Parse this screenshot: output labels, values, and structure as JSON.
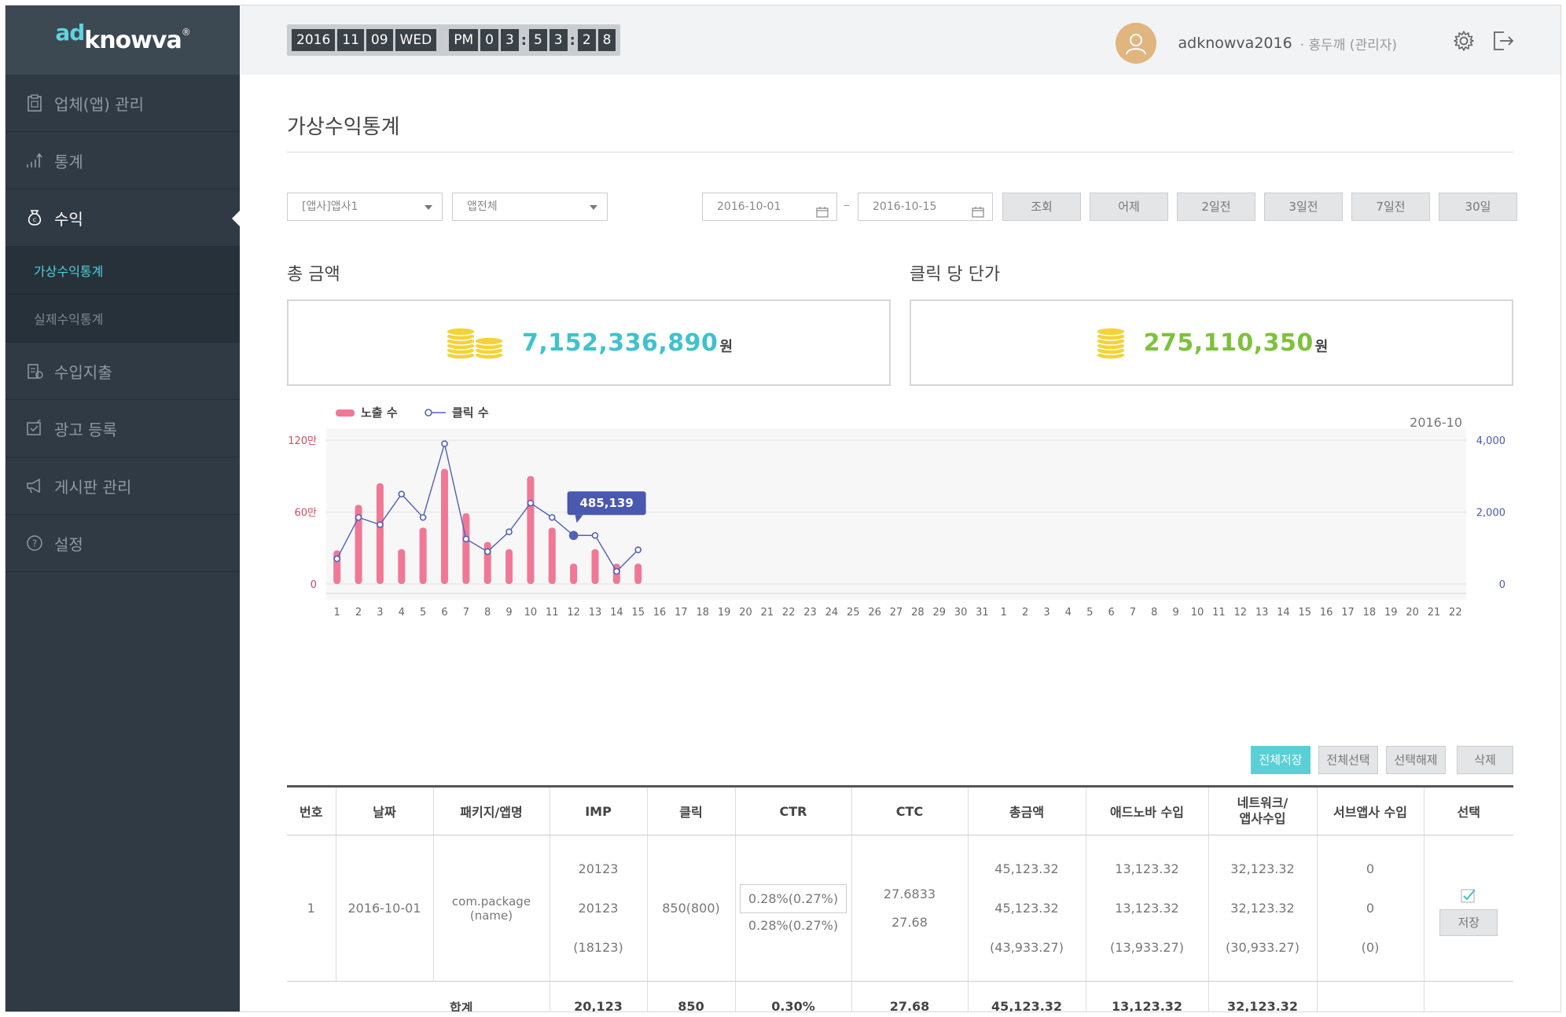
{
  "logo": {
    "ad": "ad",
    "knowva": "knowva",
    "reg": "®"
  },
  "sidebar": {
    "items": [
      {
        "label": "업체(앱) 관리",
        "icon": "clipboard-icon"
      },
      {
        "label": "통계",
        "icon": "bar-chart-icon"
      },
      {
        "label": "수익",
        "icon": "money-bag-icon"
      },
      {
        "label": "수입지출",
        "icon": "receipt-icon"
      },
      {
        "label": "광고 등록",
        "icon": "edit-check-icon"
      },
      {
        "label": "게시판 관리",
        "icon": "megaphone-icon"
      },
      {
        "label": "설정",
        "icon": "question-circle-icon"
      }
    ],
    "subitems": [
      {
        "label": "가상수익통계"
      },
      {
        "label": "실제수익통계"
      }
    ]
  },
  "clock": {
    "year": "2016",
    "month": "11",
    "day": "09",
    "weekday": "WED",
    "ampm": "PM",
    "h1": "0",
    "h2": "3",
    "m1": "5",
    "m2": "3",
    "s1": "2",
    "s2": "8"
  },
  "user": {
    "id": "adknowva2016",
    "sep": "·",
    "role": "홍두깨 (관리자)"
  },
  "page": {
    "title": "가상수익통계"
  },
  "filters": {
    "company_select": "[앱사]앱사1",
    "app_select": "앱전체",
    "date_from": "2016-10-01",
    "date_to": "2016-10-15",
    "dash": "–",
    "buttons": [
      "조회",
      "어제",
      "2일전",
      "3일전",
      "7일전",
      "30일"
    ]
  },
  "summary": {
    "total_label": "총 금액",
    "total_value": "7,152,336,890",
    "total_unit": "원",
    "cpc_label": "클릭 당 단가",
    "cpc_value": "275,110,350",
    "cpc_unit": "원",
    "colors": {
      "total": "#3fc2cc",
      "cpc": "#7cc23a",
      "coin": "#f3d33a"
    }
  },
  "chart_data": {
    "type": "bar",
    "period_label": "2016-10",
    "legend": [
      "노출 수",
      "클릭 수"
    ],
    "categories": [
      "1",
      "2",
      "3",
      "4",
      "5",
      "6",
      "7",
      "8",
      "9",
      "10",
      "11",
      "12",
      "13",
      "14",
      "15",
      "16",
      "17",
      "18",
      "19",
      "20",
      "21",
      "22",
      "23",
      "24",
      "25",
      "26",
      "27",
      "28",
      "29",
      "30",
      "31",
      "1",
      "2",
      "3",
      "4",
      "5",
      "6",
      "7",
      "8",
      "9",
      "10",
      "11",
      "12",
      "13",
      "14",
      "15",
      "16",
      "17",
      "18",
      "19",
      "20",
      "21",
      "22"
    ],
    "series": [
      {
        "name": "노출 수",
        "type": "bar",
        "axis": "left",
        "color": "#f07896",
        "values": [
          280000,
          660000,
          840000,
          290000,
          470000,
          960000,
          590000,
          350000,
          290000,
          900000,
          470000,
          170000,
          290000,
          170000,
          170000
        ]
      },
      {
        "name": "클릭 수",
        "type": "line",
        "axis": "right",
        "color": "#5160b8",
        "values": [
          700,
          1850,
          1650,
          2500,
          1850,
          3900,
          1250,
          900,
          1450,
          2250,
          1850,
          1350,
          1350,
          350,
          950
        ]
      }
    ],
    "left_axis": {
      "ticks": [
        "0",
        "60만",
        "120만"
      ],
      "range": [
        0,
        1200000
      ]
    },
    "right_axis": {
      "ticks": [
        "0",
        "2,000",
        "4,000"
      ],
      "range": [
        0,
        4000
      ]
    },
    "tooltip": {
      "category_index": 11,
      "value": "485,139"
    },
    "grid": true
  },
  "table_actions": [
    "전체저장",
    "전체선택",
    "선택해제",
    "삭제"
  ],
  "table": {
    "headers": [
      "번호",
      "날짜",
      "패키지/앱명",
      "IMP",
      "클릭",
      "CTR",
      "CTC",
      "총금액",
      "애드노바 수입",
      "네트워크/\n앱사수입",
      "서브앱사 수입",
      "선택"
    ],
    "rows": [
      {
        "no": "1",
        "date": "2016-10-01",
        "package": "com.package\n(name)",
        "imp": [
          "20123",
          "20123",
          "(18123)"
        ],
        "click": "850(800)",
        "ctr": [
          "0.28%(0.27%)",
          "0.28%(0.27%)"
        ],
        "ctc": [
          "27.6833",
          "27.68"
        ],
        "total": [
          "45,123.32",
          "45,123.32",
          "(43,933.27)"
        ],
        "adnova": [
          "13,123.32",
          "13,123.32",
          "(13,933.27)"
        ],
        "network": [
          "32,123.32",
          "32,123.32",
          "(30,933.27)"
        ],
        "sub": [
          "0",
          "0",
          "(0)"
        ],
        "save": "저장"
      }
    ],
    "total": {
      "label": "합계",
      "imp": "20,123",
      "click": "850",
      "ctr": "0.30%",
      "ctc": "27.68",
      "total": "45,123.32",
      "adnova": "13,123.32",
      "network": "32,123.32"
    }
  }
}
